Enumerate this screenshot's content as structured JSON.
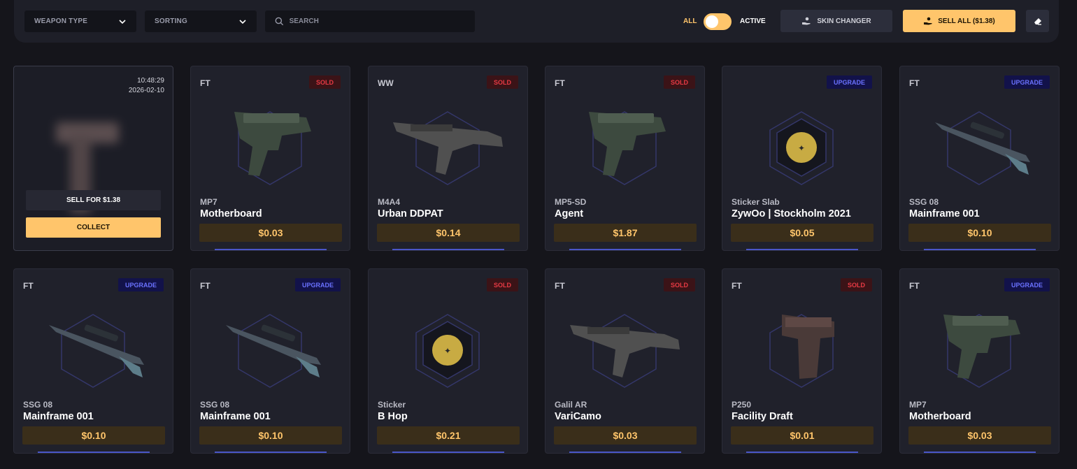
{
  "toolbar": {
    "weapon_type_label": "WEAPON TYPE",
    "sorting_label": "SORTING",
    "search_placeholder": "SEARCH",
    "toggle_all_label": "ALL",
    "toggle_active_label": "ACTIVE",
    "toggle_active": false,
    "skin_changer_label": "SKIN CHANGER",
    "sell_all_label": "SELL ALL ($1.38)"
  },
  "pending_card": {
    "time": "10:48:29",
    "date": "2026-02-10",
    "sell_label": "SELL FOR $1.38",
    "collect_label": "COLLECT"
  },
  "items": [
    {
      "wear": "FT",
      "status": "SOLD",
      "type": "MP7",
      "name": "Motherboard",
      "price": "$0.03",
      "icon": "smg-icon"
    },
    {
      "wear": "WW",
      "status": "SOLD",
      "type": "M4A4",
      "name": "Urban DDPAT",
      "price": "$0.14",
      "icon": "rifle-icon"
    },
    {
      "wear": "FT",
      "status": "SOLD",
      "type": "MP5-SD",
      "name": "Agent",
      "price": "$1.87",
      "icon": "smg-icon"
    },
    {
      "wear": "",
      "status": "UPGRADE",
      "type": "Sticker Slab",
      "name": "ZywOo | Stockholm 2021",
      "price": "$0.05",
      "icon": "sticker-icon"
    },
    {
      "wear": "FT",
      "status": "UPGRADE",
      "type": "SSG 08",
      "name": "Mainframe 001",
      "price": "$0.10",
      "icon": "sniper-icon"
    },
    {
      "wear": "FT",
      "status": "UPGRADE",
      "type": "SSG 08",
      "name": "Mainframe 001",
      "price": "$0.10",
      "icon": "sniper-icon"
    },
    {
      "wear": "FT",
      "status": "UPGRADE",
      "type": "SSG 08",
      "name": "Mainframe 001",
      "price": "$0.10",
      "icon": "sniper-icon"
    },
    {
      "wear": "",
      "status": "SOLD",
      "type": "Sticker",
      "name": "B Hop",
      "price": "$0.21",
      "icon": "sticker-icon"
    },
    {
      "wear": "FT",
      "status": "SOLD",
      "type": "Galil AR",
      "name": "VariCamo",
      "price": "$0.03",
      "icon": "rifle-icon"
    },
    {
      "wear": "FT",
      "status": "SOLD",
      "type": "P250",
      "name": "Facility Draft",
      "price": "$0.01",
      "icon": "pistol-icon"
    },
    {
      "wear": "FT",
      "status": "UPGRADE",
      "type": "MP7",
      "name": "Motherboard",
      "price": "$0.03",
      "icon": "smg-icon"
    }
  ],
  "colors": {
    "accent": "#ffc56b",
    "sold": "#e83a44",
    "upgrade": "#6a72ff",
    "background": "#15151b",
    "card": "#20212b"
  }
}
